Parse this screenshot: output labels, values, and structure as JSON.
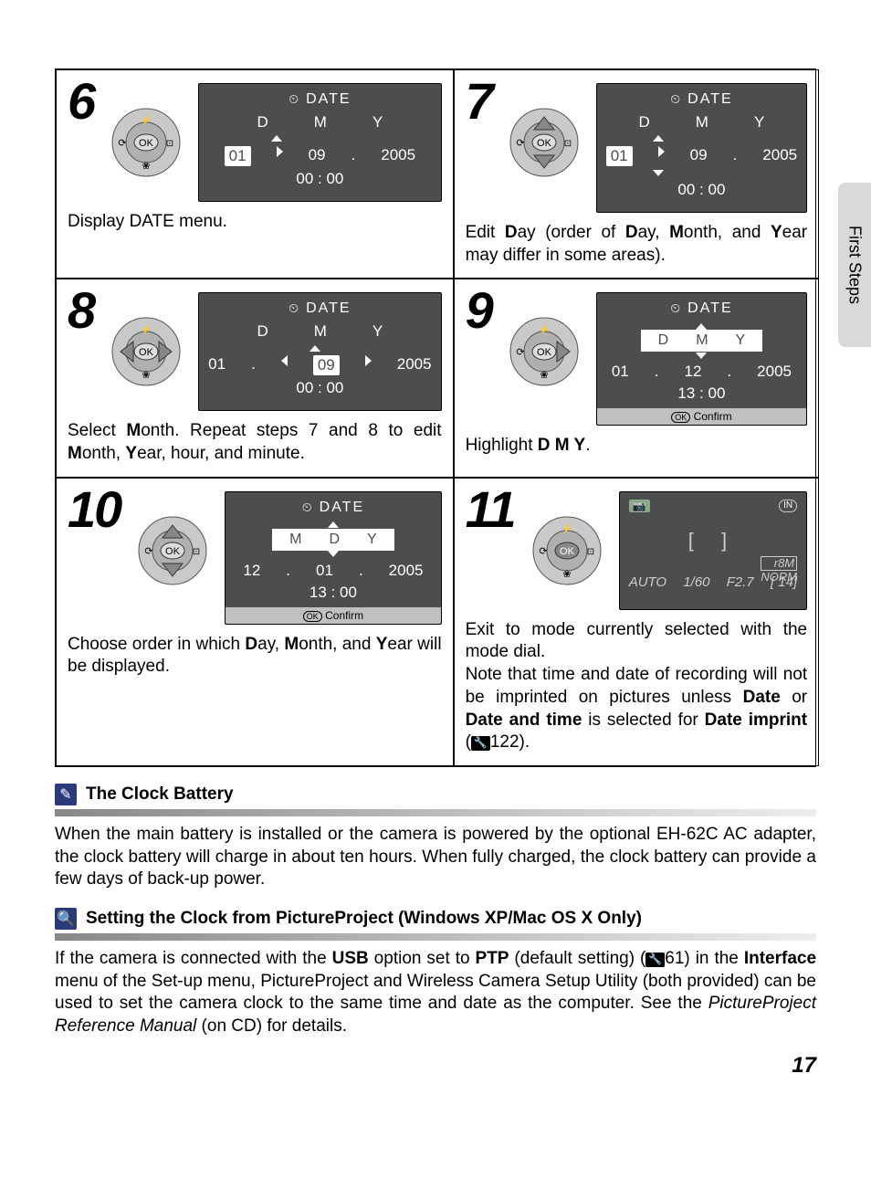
{
  "side_tab": "First Steps",
  "page_number": "17",
  "steps": {
    "s6": {
      "num": "6",
      "screen": {
        "title": "DATE",
        "labels": [
          "D",
          "M",
          "Y"
        ],
        "values": [
          "01",
          "09",
          "2005"
        ],
        "time": "00  :  00"
      },
      "caption": "Display DATE menu."
    },
    "s7": {
      "num": "7",
      "screen": {
        "title": "DATE",
        "labels": [
          "D",
          "M",
          "Y"
        ],
        "values": [
          "01",
          "09",
          "2005"
        ],
        "time": "00  :  00"
      },
      "caption_parts": {
        "a": "Edit ",
        "b": "D",
        "c": "ay (order of ",
        "d": "D",
        "e": "ay, ",
        "f": "M",
        "g": "onth, and ",
        "h": "Y",
        "i": "ear may differ in some areas)."
      }
    },
    "s8": {
      "num": "8",
      "screen": {
        "title": "DATE",
        "labels": [
          "D",
          "M",
          "Y"
        ],
        "values": [
          "01",
          "09",
          "2005"
        ],
        "time": "00  :  00"
      },
      "caption_parts": {
        "a": "Select ",
        "b": "M",
        "c": "onth. Repeat steps 7 and 8 to edit ",
        "d": "M",
        "e": "onth, ",
        "f": "Y",
        "g": "ear, hour, and minute."
      }
    },
    "s9": {
      "num": "9",
      "screen": {
        "title": "DATE",
        "labels": [
          "D",
          "M",
          "Y"
        ],
        "values": [
          "01",
          "12",
          "2005"
        ],
        "time": "13  :  00",
        "confirm": "OK Confirm"
      },
      "caption_parts": {
        "a": "Highlight ",
        "b": "D M Y",
        "c": "."
      }
    },
    "s10": {
      "num": "10",
      "screen": {
        "title": "DATE",
        "labels": [
          "M",
          "D",
          "Y"
        ],
        "values": [
          "12",
          "01",
          "2005"
        ],
        "time": "13  :  00",
        "confirm": "OK Confirm"
      },
      "caption_parts": {
        "a": "Choose order in which ",
        "b": "D",
        "c": "ay, ",
        "d": "M",
        "e": "onth, and ",
        "f": "Y",
        "g": "ear will be displayed."
      }
    },
    "s11": {
      "num": "11",
      "screen": {
        "top_left": "📷",
        "top_right": "IN",
        "brackets": "[ ]",
        "right1": "8M",
        "right2": "NORM",
        "bottom": [
          "AUTO",
          "1/60",
          "F2.7",
          "[   14]"
        ]
      },
      "caption_parts": {
        "a": "Exit to mode currently selected with the mode dial.",
        "b": "Note that time and date of recording will not be imprinted on pictures unless ",
        "c": "Date",
        "d": " or ",
        "e": "Date and time",
        "f": " is selected for ",
        "g": "Date imprint",
        "h": " (",
        "i": "122)."
      }
    }
  },
  "notes": {
    "clock_title": "The Clock Battery",
    "clock_body": "When the main battery is installed or the camera is powered by the optional EH-62C AC adapter, the clock battery will charge in about ten hours. When fully charged, the clock battery can provide a few days of back-up power.",
    "pp_title": "Setting the Clock from PictureProject (Windows XP/Mac OS X Only)",
    "pp_body_parts": {
      "a": "If the camera is connected with the ",
      "b": "USB",
      "c": " option set to ",
      "d": "PTP",
      "e": " (default setting) (",
      "f": "61) in the ",
      "g": "Interface",
      "h": " menu of the Set-up menu, PictureProject and Wireless Camera Setup Utility (both provided) can be used to set the camera clock to the same time and date as the computer. See the ",
      "i": "PictureProject Reference Manual",
      "j": " (on CD) for details."
    }
  }
}
